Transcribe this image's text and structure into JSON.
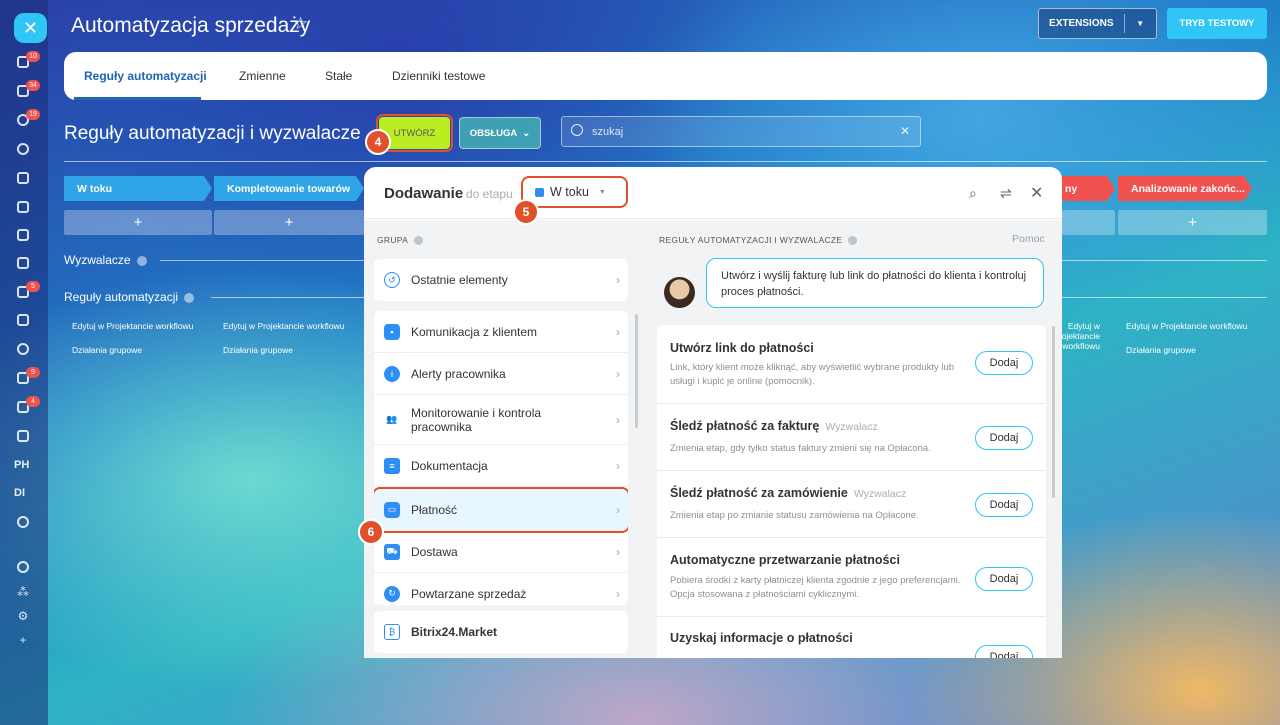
{
  "header": {
    "title": "Automatyzacja sprzedaży",
    "extensions_label": "EXTENSIONS",
    "test_mode_label": "TRYB TESTOWY"
  },
  "rail": {
    "badges": [
      "10",
      "34",
      "19",
      "5",
      "9",
      "4"
    ],
    "texts": [
      "PH",
      "DI"
    ]
  },
  "tabs": [
    {
      "label": "Reguły automatyzacji",
      "active": true
    },
    {
      "label": "Zmienne"
    },
    {
      "label": "Stałe"
    },
    {
      "label": "Dzienniki testowe"
    }
  ],
  "toolbar": {
    "section_title": "Reguły automatyzacji i wyzwalacze",
    "create_label": "UTWÓRZ",
    "service_label": "OBSŁUGA",
    "search_placeholder": "szukaj"
  },
  "stages": [
    {
      "label": "W toku",
      "color": "#2fa4e7"
    },
    {
      "label": "Kompletowanie towarów",
      "color": "#2fa4e7"
    },
    {
      "label": "ny",
      "color": "#f0524f"
    },
    {
      "label": "Analizowanie zakońc...",
      "color": "#f0524f"
    }
  ],
  "board": {
    "triggers_label": "Wyzwalacze",
    "rules_label": "Reguły automatyzacji",
    "edit_link": "Edytuj w Projektancie workflowu",
    "group_actions": "Działania grupowe",
    "plus": "+"
  },
  "modal": {
    "title": "Dodawanie",
    "subtitle": "do etapu",
    "stage": "W toku",
    "group_label": "GRUPA",
    "rules_label": "REGUŁY AUTOMATYZACJI I WYZWALACZE",
    "help_label": "Pomoc",
    "groups": [
      {
        "label": "Ostatnie elementy"
      },
      {
        "label": "Komunikacja z klientem"
      },
      {
        "label": "Alerty pracownika"
      },
      {
        "label": "Monitorowanie i kontrola pracownika"
      },
      {
        "label": "Dokumentacja"
      },
      {
        "label": "Płatność",
        "selected": true
      },
      {
        "label": "Dostawa"
      },
      {
        "label": "Powtarzane sprzedaż"
      },
      {
        "label": "Bitrix24.Market"
      }
    ],
    "bubble_text": "Utwórz i wyślij fakturę lub link do płatności do klienta i kontroluj proces płatności.",
    "rules": [
      {
        "title": "Utwórz link do płatności",
        "trigger": "",
        "desc": "Link, który klient może kliknąć, aby wyświetlić wybrane produkty lub usługi i kupić je online (pomocnik)."
      },
      {
        "title": "Śledź płatność za fakturę",
        "trigger": "Wyzwalacz",
        "desc": "Zmienia etap, gdy tylko status faktury zmieni się na Opłacona."
      },
      {
        "title": "Śledź płatność za zamówienie",
        "trigger": "Wyzwalacz",
        "desc": "Zmienia etap po zmianie statusu zamówienia na Opłacone."
      },
      {
        "title": "Automatyczne przetwarzanie płatności",
        "trigger": "",
        "desc": "Pobiera środki z karty płatniczej klienta zgodnie z jego preferencjami. Opcja stosowana z płatnościami cyklicznymi."
      },
      {
        "title": "Uzyskaj informacje o płatności",
        "trigger": "",
        "desc": ""
      }
    ],
    "add_label": "Dodaj"
  },
  "annotations": [
    "4",
    "5",
    "6"
  ]
}
